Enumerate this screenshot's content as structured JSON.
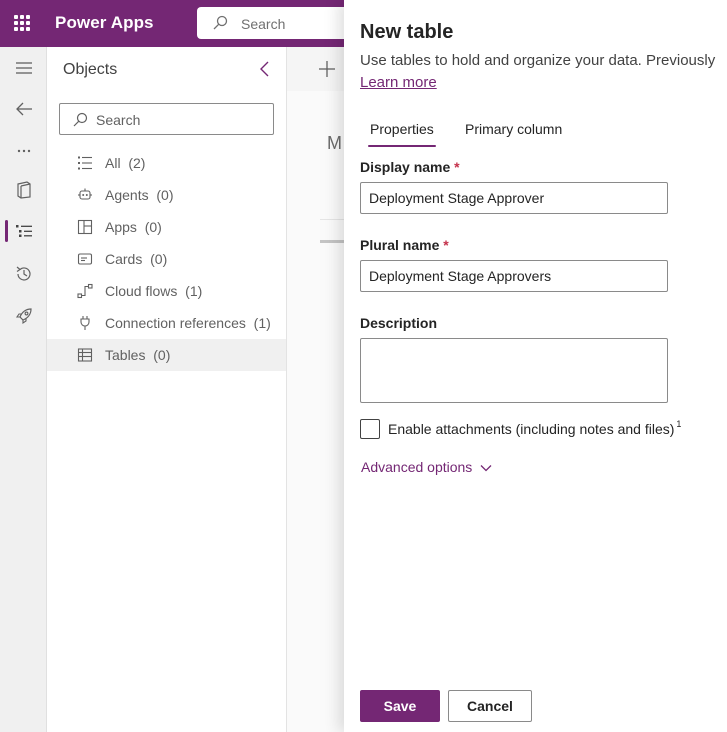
{
  "header": {
    "app_name": "Power Apps",
    "search_placeholder": "Search"
  },
  "rail": {
    "items": [
      "menu-icon",
      "back-arrow-icon",
      "more-icon",
      "book-icon",
      "tree-view-icon",
      "history-icon",
      "rocket-icon"
    ],
    "active": "tree-view-icon"
  },
  "objects": {
    "title": "Objects",
    "search_placeholder": "Search",
    "items": [
      {
        "label": "All",
        "count": "(2)",
        "icon": "list-icon"
      },
      {
        "label": "Agents",
        "count": "(0)",
        "icon": "agent-icon"
      },
      {
        "label": "Apps",
        "count": "(0)",
        "icon": "apps-icon"
      },
      {
        "label": "Cards",
        "count": "(0)",
        "icon": "card-icon"
      },
      {
        "label": "Cloud flows",
        "count": "(1)",
        "icon": "flow-icon"
      },
      {
        "label": "Connection references",
        "count": "(1)",
        "icon": "plug-icon"
      },
      {
        "label": "Tables",
        "count": "(0)",
        "icon": "table-icon"
      }
    ],
    "selected": "Tables"
  },
  "canvas": {
    "partial_heading": "M"
  },
  "panel": {
    "title": "New table",
    "description": "Use tables to hold and organize your data. Previously",
    "learn_more": "Learn more",
    "tabs": [
      "Properties",
      "Primary column"
    ],
    "active_tab": "Properties",
    "display_name": {
      "label": "Display name",
      "required_mark": "*",
      "value": "Deployment Stage Approver"
    },
    "plural_name": {
      "label": "Plural name",
      "required_mark": "*",
      "value": "Deployment Stage Approvers"
    },
    "description_field": {
      "label": "Description",
      "value": ""
    },
    "attachments": {
      "label": "Enable attachments (including notes and files)",
      "footnote": "1",
      "checked": false
    },
    "advanced_options": "Advanced options",
    "save_label": "Save",
    "cancel_label": "Cancel"
  },
  "colors": {
    "brand": "#742774",
    "required": "#c4314b"
  }
}
